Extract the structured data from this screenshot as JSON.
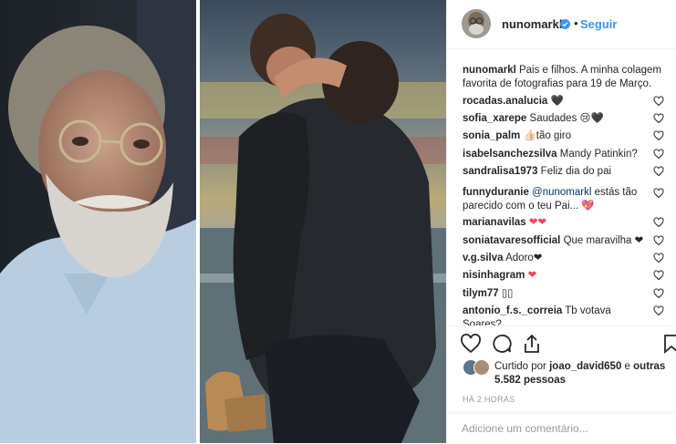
{
  "post": {
    "username": "nunomarkl",
    "follow_label": "Seguir",
    "separator": "•",
    "caption_user": "nunomarkl",
    "caption_text": " Pais e filhos. A minha colagem favorita de fotografias para 19 de Março."
  },
  "comments": [
    {
      "user": "rocadas.analucia",
      "text": " 🖤"
    },
    {
      "user": "sofia_xarepe",
      "text": " Saudades 😢🖤"
    },
    {
      "user": "sonia_palm",
      "text": " 👍🏻tão giro"
    },
    {
      "user": "isabelsanchezsilva",
      "text": " Mandy Patinkin?"
    },
    {
      "user": "sandralisa1973",
      "text": " Feliz dia do pai"
    },
    {
      "user": "funnyduranie",
      "mention": " @nunomarkl",
      "text": " estás tão parecido com o teu Pai... 💖"
    },
    {
      "user": "marianavilas",
      "text": " ❤❤"
    },
    {
      "user": "soniatavaresofficial",
      "text": " Que maravilha ❤"
    },
    {
      "user": "v.g.silva",
      "text": " Adoro❤"
    },
    {
      "user": "nisinhagram",
      "text": " ❤"
    },
    {
      "user": "tilym77",
      "text": " ▯▯"
    },
    {
      "user": "antonio_f.s._correia",
      "text": " Tb votava Soares?"
    }
  ],
  "likes": {
    "prefix": "Curtido por ",
    "user": "joao_david650",
    "middle": " e ",
    "others": "outras 5.582 pessoas"
  },
  "time_ago": "HÁ 2 HORAS",
  "add_comment_placeholder": "Adicione um comentário...",
  "icons": {
    "like": "heart-outline-icon",
    "comment": "comment-bubble-icon",
    "share": "share-icon",
    "save": "bookmark-icon",
    "verified": "verified-badge-icon"
  },
  "colors": {
    "link_blue": "#3897f0",
    "heart_red": "#ed4956",
    "text": "#262626",
    "muted": "#999999"
  }
}
